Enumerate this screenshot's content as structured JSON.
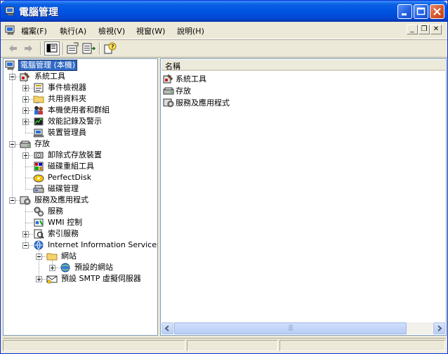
{
  "window": {
    "title": "電腦管理"
  },
  "menu": [
    "檔案(F)",
    "執行(A)",
    "檢視(V)",
    "視窗(W)",
    "說明(H)"
  ],
  "tree": [
    {
      "label": "電腦管理 (本機)",
      "level": 0,
      "icon": "computer-icon",
      "expander": "none",
      "selected": true
    },
    {
      "label": "系統工具",
      "level": 1,
      "icon": "system-tools-icon",
      "expander": "minus"
    },
    {
      "label": "事件檢視器",
      "level": 2,
      "icon": "event-viewer-icon",
      "expander": "plus"
    },
    {
      "label": "共用資料夾",
      "level": 2,
      "icon": "shared-folder-icon",
      "expander": "plus"
    },
    {
      "label": "本機使用者和群組",
      "level": 2,
      "icon": "users-icon",
      "expander": "plus"
    },
    {
      "label": "效能記錄及警示",
      "level": 2,
      "icon": "performance-icon",
      "expander": "plus"
    },
    {
      "label": "裝置管理員",
      "level": 2,
      "icon": "device-manager-icon",
      "expander": "none"
    },
    {
      "label": "存放",
      "level": 1,
      "icon": "storage-icon",
      "expander": "minus"
    },
    {
      "label": "卸除式存放裝置",
      "level": 2,
      "icon": "removable-storage-icon",
      "expander": "plus"
    },
    {
      "label": "磁碟重組工具",
      "level": 2,
      "icon": "defrag-icon",
      "expander": "none"
    },
    {
      "label": "PerfectDisk",
      "level": 2,
      "icon": "perfectdisk-icon",
      "expander": "none"
    },
    {
      "label": "磁碟管理",
      "level": 2,
      "icon": "disk-management-icon",
      "expander": "none"
    },
    {
      "label": "服務及應用程式",
      "level": 1,
      "icon": "services-apps-icon",
      "expander": "minus"
    },
    {
      "label": "服務",
      "level": 2,
      "icon": "services-icon",
      "expander": "none"
    },
    {
      "label": "WMI 控制",
      "level": 2,
      "icon": "wmi-icon",
      "expander": "none"
    },
    {
      "label": "索引服務",
      "level": 2,
      "icon": "indexing-icon",
      "expander": "plus"
    },
    {
      "label": "Internet Information Services",
      "level": 2,
      "icon": "iis-icon",
      "expander": "minus"
    },
    {
      "label": "網站",
      "level": 3,
      "icon": "folder-icon",
      "expander": "minus"
    },
    {
      "label": "預設的網站",
      "level": 4,
      "icon": "website-icon",
      "expander": "plus"
    },
    {
      "label": "預設 SMTP 虛擬伺服器",
      "level": 3,
      "icon": "smtp-icon",
      "expander": "plus"
    }
  ],
  "list": {
    "column": "名稱",
    "items": [
      {
        "label": "系統工具",
        "icon": "system-tools-icon"
      },
      {
        "label": "存放",
        "icon": "storage-icon"
      },
      {
        "label": "服務及應用程式",
        "icon": "services-apps-icon"
      }
    ]
  },
  "scrollbar_grip": "|||",
  "colors": {
    "title_bar": "#0054e3",
    "selection": "#316ac5",
    "face": "#ece9d8"
  }
}
